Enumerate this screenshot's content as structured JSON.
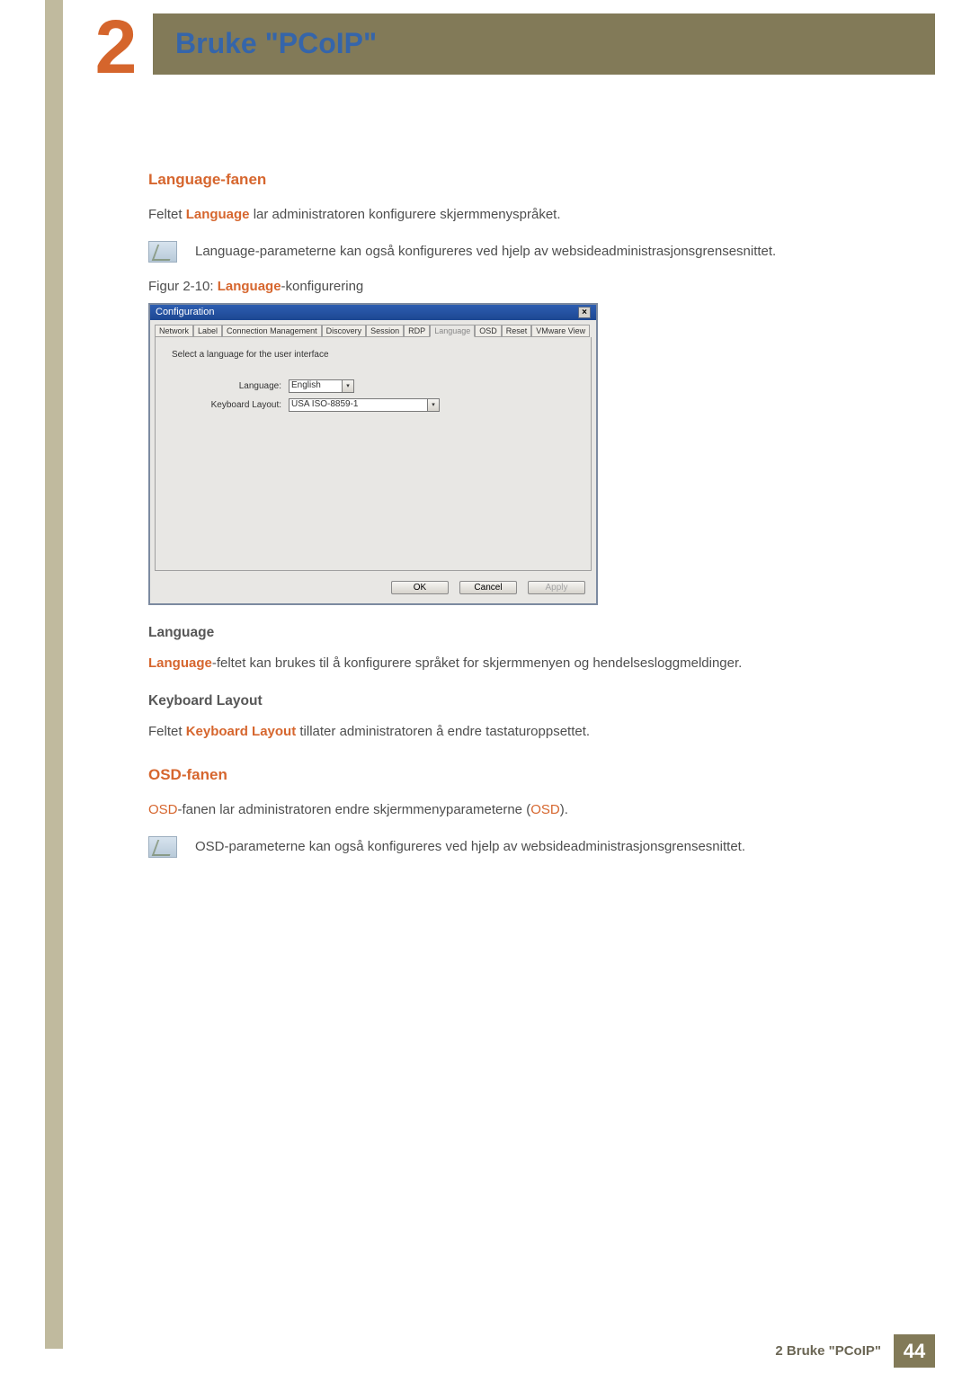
{
  "header": {
    "chapter_number": "2",
    "chapter_title": "Bruke \"PCoIP\""
  },
  "section1": {
    "heading": "Language-fanen",
    "intro_pre": "Feltet ",
    "intro_hl": "Language",
    "intro_post": " lar administratoren konfigurere skjermmenyspråket.",
    "note": "Language-parameterne kan også konfigureres ved hjelp av websideadministrasjonsgrensesnittet.",
    "fig_caption_pre": "Figur 2-10: ",
    "fig_caption_hl": "Language",
    "fig_caption_post": "-konfigurering"
  },
  "dialog": {
    "title": "Configuration",
    "tabs": {
      "network": "Network",
      "label": "Label",
      "cm": "Connection Management",
      "discovery": "Discovery",
      "session": "Session",
      "rdp": "RDP",
      "language": "Language",
      "osd": "OSD",
      "reset": "Reset",
      "vmware": "VMware View"
    },
    "body_caption": "Select a language for the user interface",
    "field_language_label": "Language:",
    "field_language_value": "English",
    "field_kbd_label": "Keyboard Layout:",
    "field_kbd_value": "USA ISO-8859-1",
    "btn_ok": "OK",
    "btn_cancel": "Cancel",
    "btn_apply": "Apply"
  },
  "language_block": {
    "heading": "Language",
    "body_hl": "Language",
    "body_post": "-feltet kan brukes til å konfigurere språket for skjermmenyen og hendelsesloggmeldinger."
  },
  "kbd_block": {
    "heading": "Keyboard Layout",
    "body_pre": "Feltet ",
    "body_hl": "Keyboard Layout",
    "body_post": " tillater administratoren å endre tastaturoppsettet."
  },
  "section2": {
    "heading": "OSD-fanen",
    "intro_hl1": "OSD",
    "intro_mid": "-fanen lar administratoren endre skjermmenyparameterne (",
    "intro_hl2": "OSD",
    "intro_end": ").",
    "note": "OSD-parameterne kan også konfigureres ved hjelp av websideadministrasjonsgrensesnittet."
  },
  "footer": {
    "label": "2 Bruke \"PCoIP\"",
    "page_number": "44"
  }
}
